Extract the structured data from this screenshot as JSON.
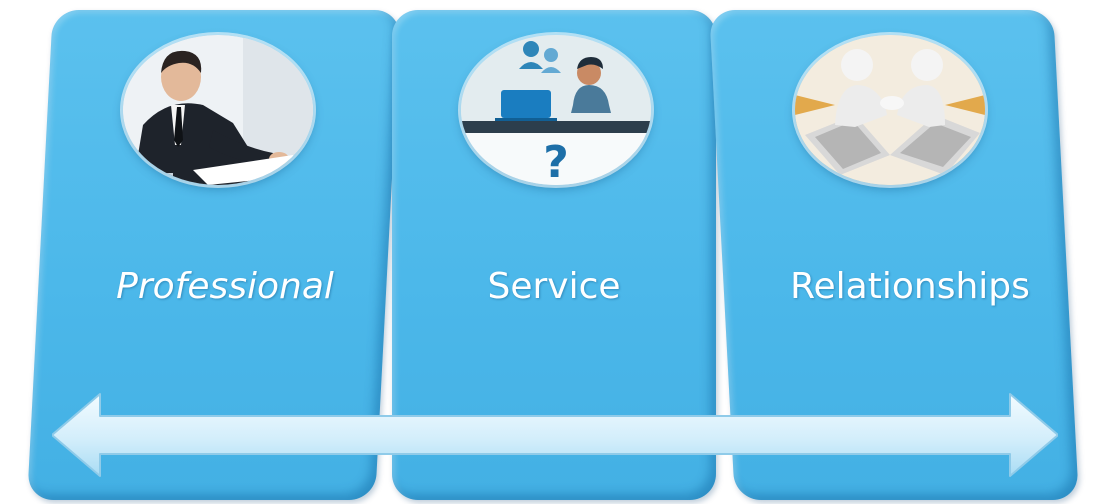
{
  "columns": [
    {
      "label": "Professional",
      "icon": "businessman-writing-icon"
    },
    {
      "label": "Service",
      "icon": "customer-support-question-icon"
    },
    {
      "label": "Relationships",
      "icon": "handshake-figures-icon"
    }
  ],
  "arrow": {
    "icon": "double-headed-arrow-icon"
  },
  "colors": {
    "panel": "#4cb8ea",
    "arrow": "#d9f0fb",
    "text": "#ffffff"
  }
}
